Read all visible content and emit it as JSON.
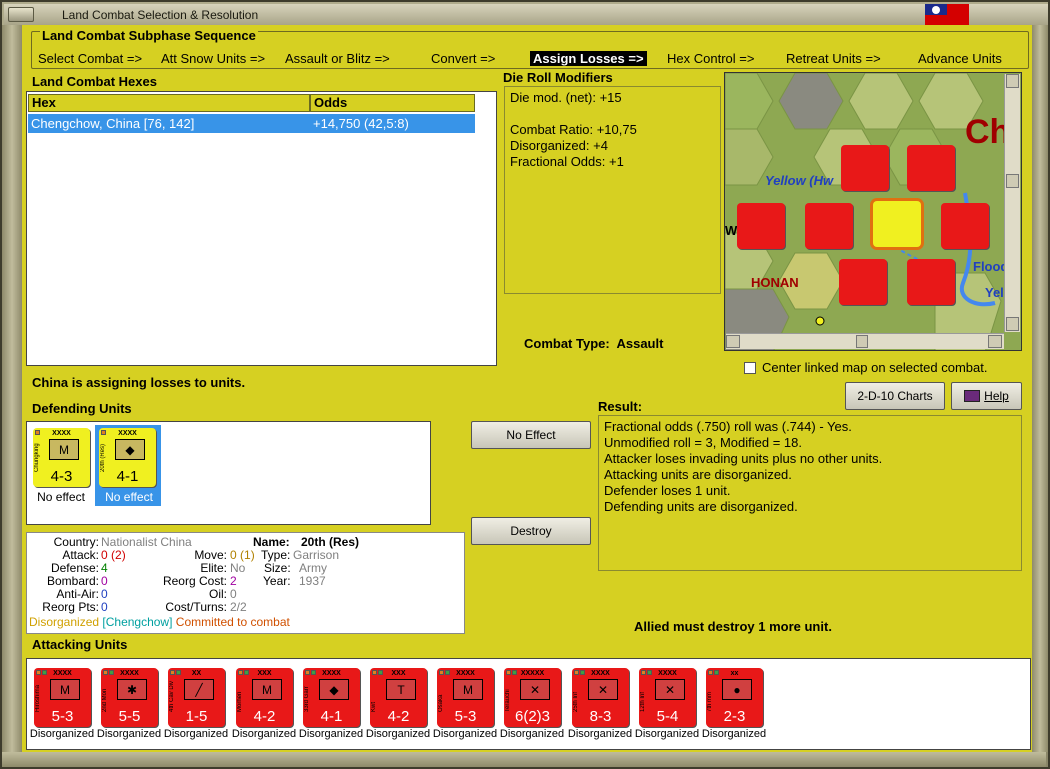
{
  "window": {
    "title": "Land Combat Selection & Resolution",
    "flag_colors": {
      "field": "#d40000",
      "canton": "#1a2a8c",
      "sun": "#ffffff"
    }
  },
  "sequence": {
    "title": "Land Combat Subphase Sequence",
    "steps": [
      "Select Combat =>",
      "Att Snow Units =>",
      "Assault or Blitz =>",
      "Convert =>",
      "Assign Losses =>",
      "Hex Control =>",
      "Retreat Units =>",
      "Advance Units"
    ],
    "active_step": "Assign Losses =>"
  },
  "combat_hexes": {
    "title": "Land Combat Hexes",
    "columns": [
      "Hex",
      "Odds"
    ],
    "rows": [
      {
        "hex": "Chengchow, China [76, 142]",
        "odds": "+14,750 (42,5:8)"
      }
    ]
  },
  "die_roll": {
    "title": "Die Roll Modifiers",
    "lines": [
      "Die mod. (net): +15",
      "",
      "Combat Ratio: +10,75",
      "Disorganized: +4",
      "Fractional Odds: +1"
    ]
  },
  "combat_type": {
    "label": "Combat Type:",
    "value": "Assault"
  },
  "map": {
    "labels": [
      "Yellow (Hw",
      "HONAN",
      "Flood",
      "Yel",
      "Ch",
      "Wa"
    ],
    "center_checkbox_label": "Center linked map on selected combat.",
    "center_checked": false
  },
  "buttons": {
    "charts": "2-D-10 Charts",
    "help": "Help",
    "no_effect": "No Effect",
    "destroy": "Destroy"
  },
  "status_message": "China is assigning losses to units.",
  "defending": {
    "title": "Defending Units",
    "units": [
      {
        "name": "Chungking",
        "size": "XXXX",
        "strength": "4-3",
        "symbol": "M",
        "status": "No effect",
        "selected": false
      },
      {
        "name": "20th (Res)",
        "size": "XXXX",
        "strength": "4-1",
        "symbol": "◆",
        "status": "No effect",
        "selected": true
      }
    ]
  },
  "unit_info": {
    "country_label": "Country:",
    "country": "Nationalist China",
    "name_label": "Name:",
    "name": "20th (Res)",
    "attack_label": "Attack:",
    "attack": "0",
    "attack_extra": "(2)",
    "move_label": "Move:",
    "move": "0",
    "move_extra": "(1)",
    "type_label": "Type:",
    "type": "Garrison",
    "defense_label": "Defense:",
    "defense": "4",
    "elite_label": "Elite:",
    "elite": "No",
    "size_label": "Size:",
    "size": "Army",
    "bombard_label": "Bombard:",
    "bombard": "0",
    "reorg_cost_label": "Reorg Cost:",
    "reorg_cost": "2",
    "year_label": "Year:",
    "year": "1937",
    "antiair_label": "Anti-Air:",
    "antiair": "0",
    "oil_label": "Oil:",
    "oil": "0",
    "reorg_pts_label": "Reorg Pts:",
    "reorg_pts": "0",
    "cost_turns_label": "Cost/Turns:",
    "cost_turns": "2/2",
    "status_disorg": "Disorganized",
    "status_hex": "[Chengchow]",
    "status_commit": "Committed to combat"
  },
  "result": {
    "title": "Result:",
    "lines": [
      "Fractional odds (.750) roll was (.744)  - Yes.",
      "Unmodified roll = 3, Modified = 18.",
      "Attacker loses invading units plus no other units.",
      "Attacking units are disorganized.",
      "Defender loses 1 unit.",
      "Defending units are disorganized."
    ]
  },
  "allied_message": "Allied must destroy 1 more unit.",
  "attacking": {
    "title": "Attacking Units",
    "units": [
      {
        "name": "Hiroshima",
        "size": "XXXX",
        "strength": "5-3",
        "symbol": "M",
        "status": "Disorganized"
      },
      {
        "name": "2nd Mon",
        "size": "XXXX",
        "strength": "5-5",
        "symbol": "✱",
        "status": "Disorganized"
      },
      {
        "name": "4th Cav Div",
        "size": "XX",
        "strength": "1-5",
        "symbol": "╱",
        "status": "Disorganized"
      },
      {
        "name": "Morhen",
        "size": "XXX",
        "strength": "4-2",
        "symbol": "M",
        "status": "Disorganized"
      },
      {
        "name": "33rd Garr",
        "size": "XXXX",
        "strength": "4-1",
        "symbol": "◆",
        "status": "Disorganized"
      },
      {
        "name": "Kwt",
        "size": "XXX",
        "strength": "4-2",
        "symbol": "T",
        "status": "Disorganized"
      },
      {
        "name": "Osaka",
        "size": "XXXX",
        "strength": "5-3",
        "symbol": "M",
        "status": "Disorganized"
      },
      {
        "name": "Terauchi",
        "size": "XXXXX",
        "strength": "6(2)3",
        "symbol": "✕",
        "status": "Disorganized"
      },
      {
        "name": "25th Inf",
        "size": "XXXX",
        "strength": "8-3",
        "symbol": "✕",
        "status": "Disorganized"
      },
      {
        "name": "12th Inf",
        "size": "XXXX",
        "strength": "5-4",
        "symbol": "✕",
        "status": "Disorganized"
      },
      {
        "name": "7th mm",
        "size": "xx",
        "strength": "2-3",
        "symbol": "●",
        "status": "Disorganized"
      }
    ]
  }
}
